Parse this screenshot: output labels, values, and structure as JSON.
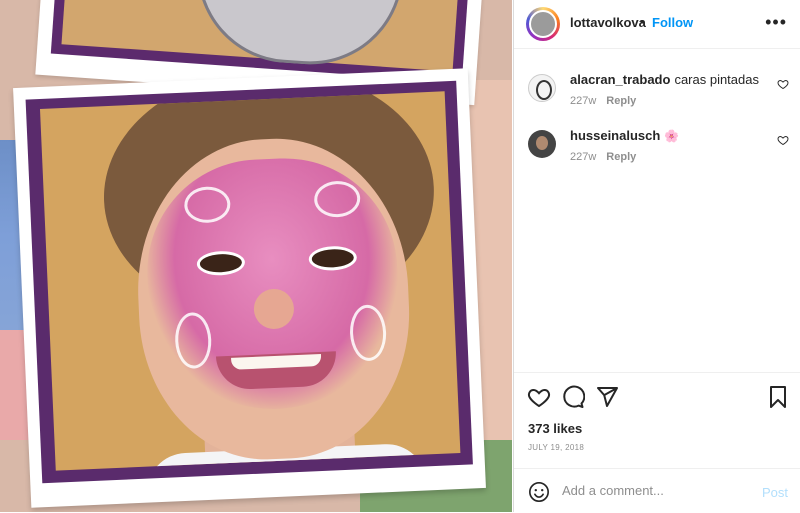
{
  "post": {
    "author": "lottavolkova",
    "separator": "•",
    "follow_label": "Follow",
    "more_icon": "more-horizontal-icon"
  },
  "comments": [
    {
      "username": "alacran_trabado",
      "text": "caras pintadas",
      "age": "227w",
      "reply_label": "Reply"
    },
    {
      "username": "husseinalusch",
      "text": "🌸",
      "age": "227w",
      "reply_label": "Reply"
    }
  ],
  "actions": {
    "like_icon": "heart-icon",
    "comment_icon": "comment-bubble-icon",
    "share_icon": "send-plane-icon",
    "save_icon": "bookmark-icon"
  },
  "stats": {
    "likes": "373 likes",
    "date": "JULY 19, 2018"
  },
  "composer": {
    "placeholder": "Add a comment...",
    "post_label": "Post"
  },
  "colors": {
    "accent": "#0095f6",
    "post_disabled": "#b2dffc",
    "frame_purple": "#5a2b6c",
    "face_paint_pink": "#d66aa6"
  }
}
